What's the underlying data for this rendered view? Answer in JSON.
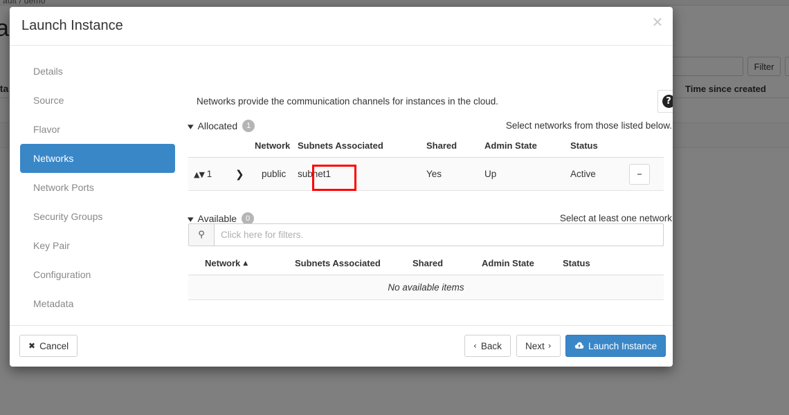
{
  "background": {
    "breadcrumb": "ault / demo",
    "page_title": "a",
    "sub_label": "sta",
    "filter_button": "Filter",
    "column_time_since_created": "Time since created"
  },
  "modal": {
    "title": "Launch Instance",
    "close_icon": "close-icon",
    "sidebar": {
      "items": [
        {
          "label": "Details",
          "active": false
        },
        {
          "label": "Source",
          "active": false
        },
        {
          "label": "Flavor",
          "active": false
        },
        {
          "label": "Networks",
          "active": true
        },
        {
          "label": "Network Ports",
          "active": false
        },
        {
          "label": "Security Groups",
          "active": false
        },
        {
          "label": "Key Pair",
          "active": false
        },
        {
          "label": "Configuration",
          "active": false
        },
        {
          "label": "Metadata",
          "active": false
        }
      ]
    },
    "content": {
      "intro": "Networks provide the communication channels for instances in the cloud.",
      "help_icon": "question-mark-icon",
      "help_glyph": "?",
      "allocated": {
        "label": "Allocated",
        "count": "1",
        "hint": "Select networks from those listed below.",
        "columns": [
          "Network",
          "Subnets Associated",
          "Shared",
          "Admin State",
          "Status"
        ],
        "rows": [
          {
            "order": "1",
            "network": "public",
            "subnets": "subnet1",
            "shared": "Yes",
            "admin_state": "Up",
            "status": "Active",
            "remove_label": "–",
            "highlighted": true
          }
        ]
      },
      "available": {
        "label": "Available",
        "count": "0",
        "hint": "Select at least one network",
        "filter_placeholder": "Click here for filters.",
        "filter_value": "",
        "search_icon": "search-icon",
        "columns": [
          "Network",
          "Subnets Associated",
          "Shared",
          "Admin State",
          "Status"
        ],
        "sort_column": "Network",
        "sort_direction_glyph": "▲",
        "empty_message": "No available items"
      }
    },
    "footer": {
      "cancel": "Cancel",
      "cancel_glyph": "✖",
      "back": "Back",
      "back_glyph": "‹",
      "next": "Next",
      "next_glyph": "›",
      "launch": "Launch Instance"
    }
  },
  "annotation": {
    "highlight_color": "#ff0000",
    "target": "public"
  }
}
